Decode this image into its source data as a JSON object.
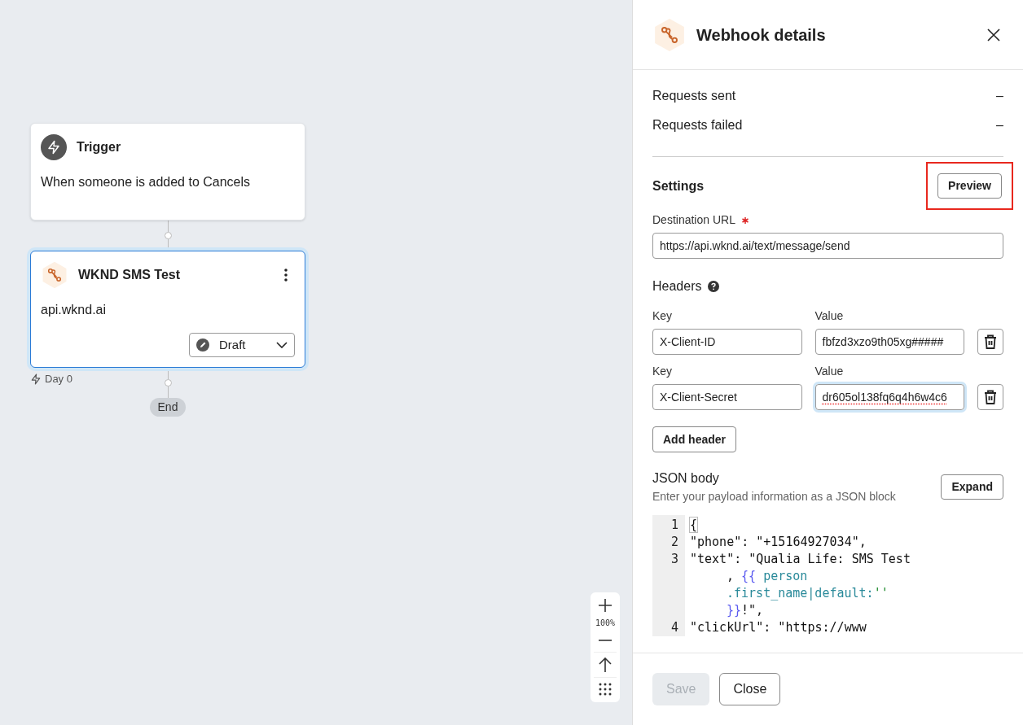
{
  "canvas": {
    "nodes": [
      {
        "kind": "trigger",
        "title": "Trigger",
        "description": "When someone is added to Cancels",
        "selected": false
      },
      {
        "kind": "webhook",
        "title": "WKND SMS Test",
        "description": "api.wknd.ai",
        "selected": true,
        "status": "Draft",
        "delay": "Day 0"
      }
    ],
    "end_label": "End",
    "zoom": {
      "level_text": "100%"
    }
  },
  "panel": {
    "title": "Webhook details",
    "stats": [
      {
        "label": "Requests sent",
        "value": "–"
      },
      {
        "label": "Requests failed",
        "value": "–"
      }
    ],
    "settings": {
      "heading": "Settings",
      "preview_button": {
        "label": "Preview",
        "highlighted": true
      },
      "destination": {
        "label": "Destination URL",
        "required": true,
        "value": "https://api.wknd.ai/text/message/send"
      },
      "headers": {
        "label": "Headers",
        "rows": [
          {
            "key_label": "Key",
            "key": "X-Client-ID",
            "value_label": "Value",
            "value": "fbfzd3xzo9th05xg#####",
            "focused": false,
            "misspelled": false
          },
          {
            "key_label": "Key",
            "key": "X-Client-Secret",
            "value_label": "Value",
            "value": "dr605ol138fq6q4h6w4c6",
            "focused": true,
            "misspelled": true
          }
        ],
        "add_button": "Add header"
      },
      "json_body": {
        "label": "JSON body",
        "hint": "Enter your payload information as a JSON block",
        "expand_button": "Expand",
        "lines": [
          {
            "number": "1",
            "rows": [
              [
                {
                  "kind": "bracket",
                  "text": "{"
                }
              ]
            ]
          },
          {
            "number": "2",
            "rows": [
              [
                {
                  "kind": "plain",
                  "text": "\"phone\": \"+15164927034\","
                }
              ]
            ]
          },
          {
            "number": "3",
            "rows": [
              [
                {
                  "kind": "plain",
                  "text": "\"text\": \"Qualia Life: SMS Test"
                }
              ],
              [
                {
                  "kind": "plain",
                  "text": ", "
                },
                {
                  "kind": "brace",
                  "text": "{{"
                },
                {
                  "kind": "variable",
                  "text": " person"
                }
              ],
              [
                {
                  "kind": "variable",
                  "text": ".first_name|default:"
                },
                {
                  "kind": "string",
                  "text": "''"
                }
              ],
              [
                {
                  "kind": "brace",
                  "text": "}}"
                },
                {
                  "kind": "plain",
                  "text": "!\","
                }
              ]
            ]
          },
          {
            "number": "4",
            "rows": [
              [
                {
                  "kind": "plain",
                  "text": "\"clickUrl\": \"https://www"
                }
              ]
            ]
          }
        ]
      }
    },
    "footer": {
      "save": {
        "label": "Save",
        "disabled": true
      },
      "close": "Close"
    }
  }
}
